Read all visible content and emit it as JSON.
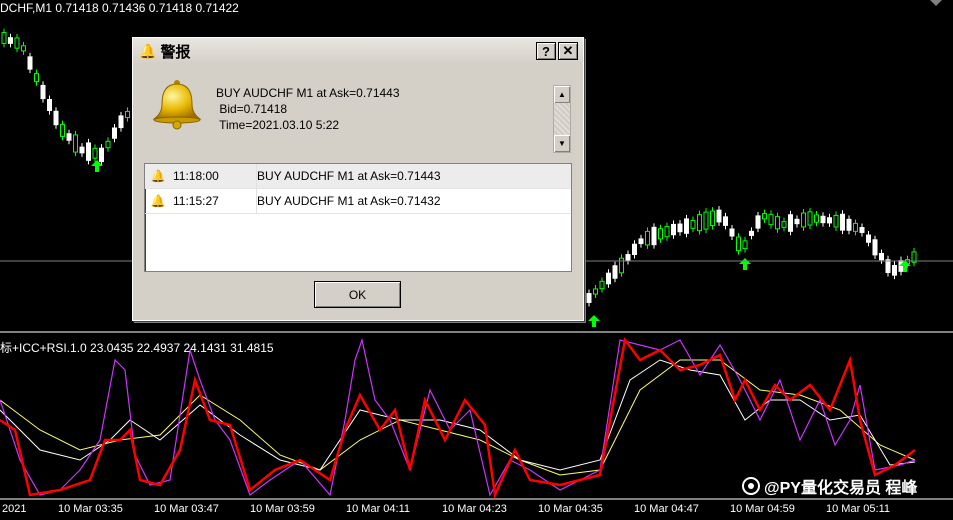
{
  "chart": {
    "symbol_label": "DCHF,M1  0.71418 0.71436 0.71418 0.71422",
    "indicator_label": "标+ICC+RSI.1.0 23.0435 22.4937 24.1431 31.4815",
    "time_labels": [
      "2021",
      "10 Mar 03:35",
      "10 Mar 03:47",
      "10 Mar 03:59",
      "10 Mar 04:11",
      "10 Mar 04:23",
      "10 Mar 04:35",
      "10 Mar 04:47",
      "10 Mar 04:59",
      "10 Mar 05:11"
    ],
    "colors": {
      "bull": "#00ff00",
      "bear": "#ffffff",
      "red": "#ff0000",
      "magenta": "#cc33ff",
      "yellow": "#ffff66",
      "white": "#ffffff",
      "arrow": "#00ff00"
    }
  },
  "dialog": {
    "title": "警报",
    "help_label": "?",
    "close_label": "✕",
    "message_lines": [
      "BUY AUDCHF M1 at Ask=0.71443",
      " Bid=0.71418",
      " Time=2021.03.10 5:22"
    ],
    "alerts": [
      {
        "time": "11:18:00",
        "message": "BUY AUDCHF M1 at Ask=0.71443"
      },
      {
        "time": "11:15:27",
        "message": "BUY AUDCHF M1 at Ask=0.71432"
      }
    ],
    "ok_label": "OK",
    "icon": "bell-icon"
  },
  "watermark": {
    "text": "@PY量化交易员 程峰"
  }
}
